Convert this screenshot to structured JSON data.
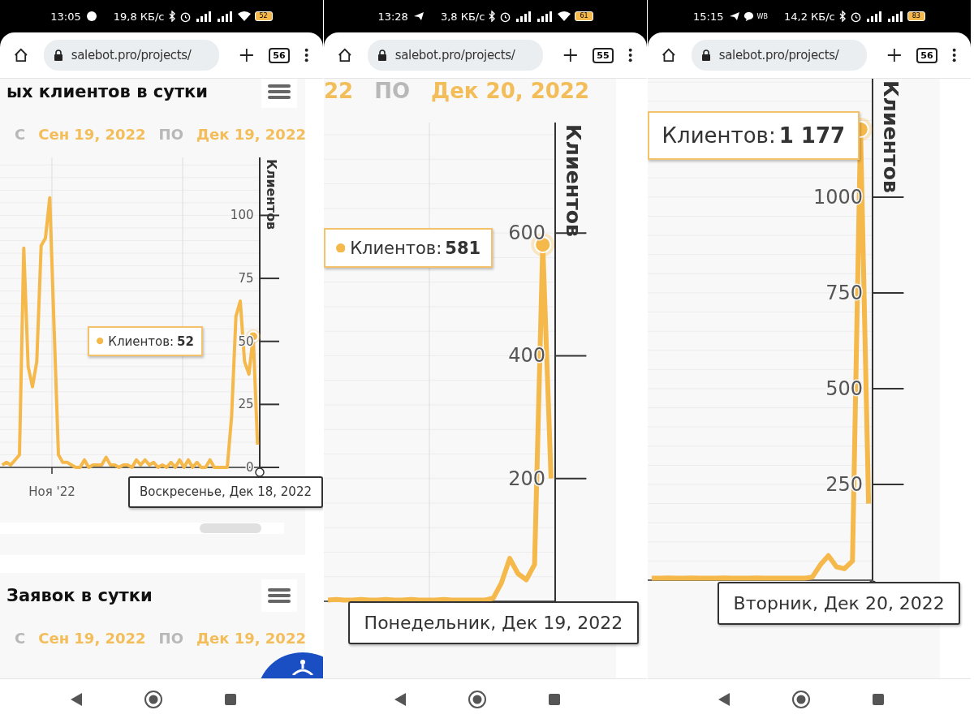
{
  "phones": [
    {
      "status_bar": {
        "time": "13:05",
        "speed": "19,8 КБ/с",
        "battery": "52"
      },
      "browser": {
        "url": "salebot.pro/projects/",
        "tab_count": "56"
      },
      "cards": [
        {
          "title": "ых клиентов в сутки",
          "date_from_label": "С",
          "date_from": "Сен 19, 2022",
          "date_to_label": "ПО",
          "date_to": "Дек 19, 2022",
          "chart_data": {
            "type": "line",
            "ylabel": "Клиентов",
            "categories": [
              null,
              null,
              null,
              null,
              null,
              null,
              null,
              null,
              null,
              null,
              null,
              null,
              null,
              null,
              null,
              null,
              null,
              null,
              null,
              null,
              null,
              null,
              null,
              null,
              null,
              null,
              null,
              null,
              null,
              null,
              null,
              null,
              null,
              null,
              null,
              null,
              null,
              null,
              null,
              null,
              null,
              null,
              null,
              null,
              null,
              null,
              null,
              null,
              null,
              null,
              null,
              null,
              null,
              null,
              null,
              null,
              null,
              null,
              null,
              null
            ],
            "series": [
              {
                "color": "#f5b84a",
                "values": [
                  1,
                  2,
                  1,
                  3,
                  5,
                  87,
                  40,
                  32,
                  42,
                  88,
                  91,
                  107,
                  55,
                  5,
                  2,
                  2,
                  1,
                  0,
                  0,
                  3,
                  0,
                  1,
                  1,
                  1,
                  4,
                  1,
                  1,
                  0,
                  1,
                  1,
                  0,
                  3,
                  1,
                  3,
                  1,
                  2,
                  0,
                  1,
                  0,
                  2,
                  0,
                  3,
                  0,
                  3,
                  0,
                  2,
                  0,
                  0,
                  3,
                  0,
                  0,
                  0,
                  0,
                  20,
                  60,
                  66,
                  42,
                  37,
                  52,
                  9
                ]
              }
            ],
            "ylim": [
              0,
              123
            ],
            "yticks": [
              0,
              25,
              50,
              75,
              100
            ],
            "grid": true,
            "annotations": [
              "Ноя '22"
            ]
          },
          "tooltip": {
            "dot": true,
            "label": "Клиентов:",
            "value": "52",
            "date": "Воскресенье, Дек 18, 2022"
          }
        },
        {
          "title": "Заявок в сутки",
          "date_from_label": "С",
          "date_from": "Сен 19, 2022",
          "date_to_label": "ПО",
          "date_to": "Дек 19, 2022"
        }
      ]
    },
    {
      "status_bar": {
        "time": "13:28",
        "speed": "3,8 КБ/с",
        "battery": "61"
      },
      "browser": {
        "url": "salebot.pro/projects/",
        "tab_count": "55"
      },
      "cards": [
        {
          "date_from": "22",
          "date_to_label": "ПО",
          "date_to": "Дек 20, 2022",
          "chart_data": {
            "type": "line",
            "ylabel": "Клиентов",
            "categories": [
              null,
              null,
              null,
              null,
              null,
              null,
              null,
              null,
              null,
              null,
              null,
              null,
              null,
              null,
              null,
              null,
              null,
              null,
              null,
              null,
              null,
              null,
              null,
              null,
              null,
              null,
              null,
              null
            ],
            "series": [
              {
                "color": "#f5b84a",
                "values": [
                  2,
                  3,
                  2,
                  2,
                  3,
                  2,
                  2,
                  3,
                  2,
                  2,
                  3,
                  2,
                  2,
                  2,
                  3,
                  2,
                  2,
                  2,
                  2,
                  2,
                  5,
                  30,
                  70,
                  45,
                  35,
                  60,
                  581,
                  200
                ]
              }
            ],
            "ylim": [
              0,
              780
            ],
            "yticks": [
              200,
              400,
              600
            ],
            "grid": true
          },
          "tooltip": {
            "dot": true,
            "label": "Клиентов:",
            "value": "581",
            "date": "Понедельник, Дек 19, 2022"
          }
        }
      ]
    },
    {
      "status_bar": {
        "time": "15:15",
        "notification_text": "WB",
        "speed": "14,2 КБ/с",
        "battery": "83"
      },
      "browser": {
        "url": "salebot.pro/projects/",
        "tab_count": "56"
      },
      "cards": [
        {
          "chart_data": {
            "type": "line",
            "ylabel": "Клиентов",
            "categories": [
              null,
              null,
              null,
              null,
              null,
              null,
              null,
              null,
              null,
              null,
              null,
              null,
              null,
              null,
              null,
              null,
              null,
              null,
              null,
              null,
              null,
              null,
              null,
              null,
              null,
              null,
              null,
              null
            ],
            "series": [
              {
                "color": "#f5b84a",
                "values": [
                  5,
                  5,
                  6,
                  5,
                  5,
                  6,
                  5,
                  5,
                  5,
                  6,
                  5,
                  5,
                  5,
                  6,
                  5,
                  5,
                  5,
                  5,
                  5,
                  5,
                  8,
                  40,
                  64,
                  35,
                  30,
                  50,
                  1177,
                  200
                ]
              }
            ],
            "ylim": [
              0,
              1309
            ],
            "yticks": [
              250,
              500,
              750,
              1000
            ],
            "grid": true
          },
          "tooltip": {
            "dot": false,
            "label": "Клиентов:",
            "value": "1 177",
            "date": "Вторник, Дек 20, 2022"
          }
        }
      ]
    }
  ]
}
